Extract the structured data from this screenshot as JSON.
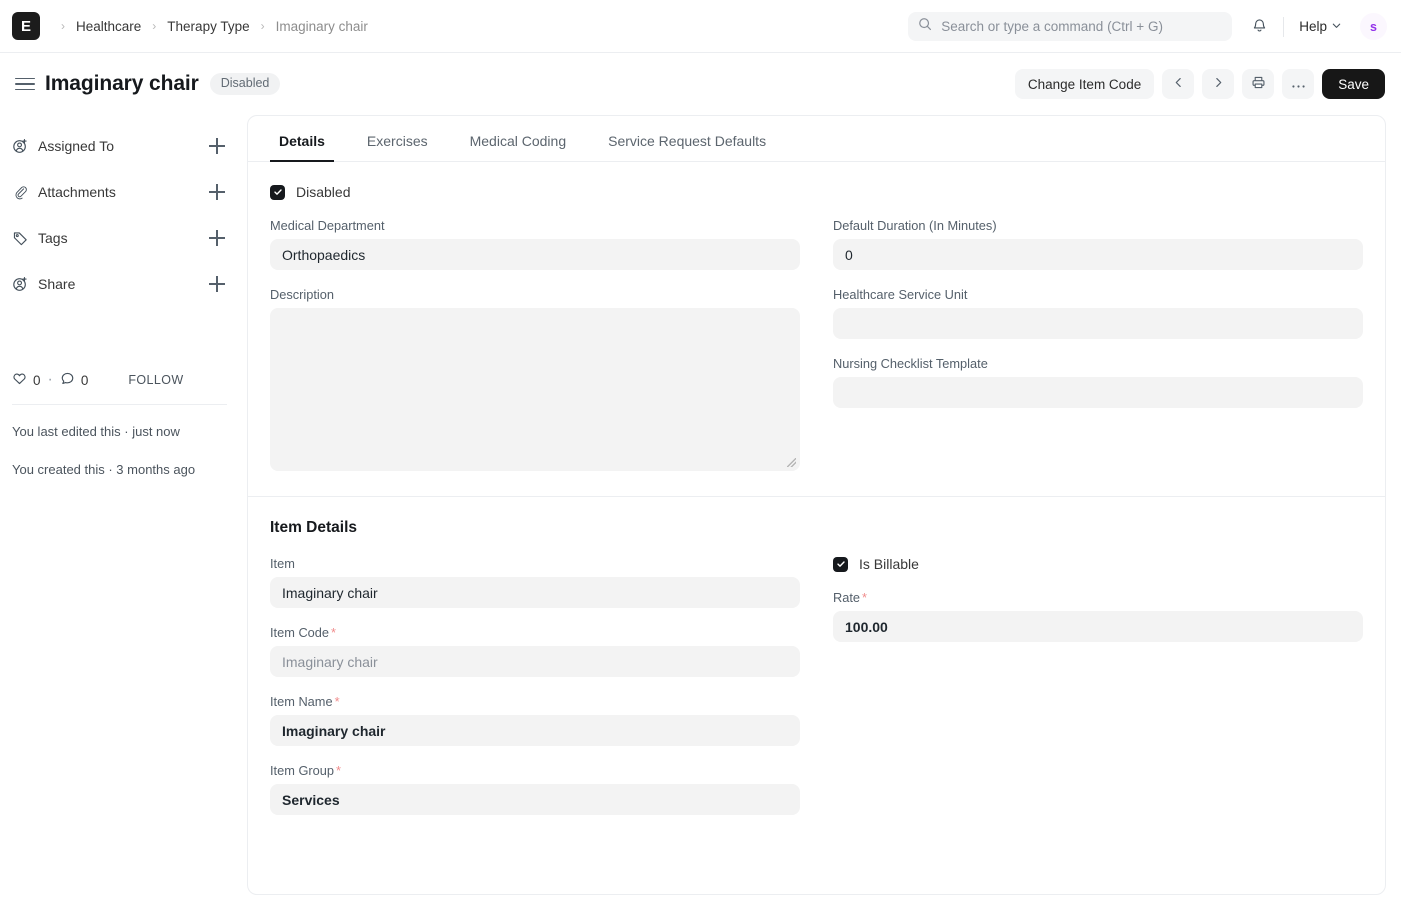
{
  "navbar": {
    "logo_letter": "E",
    "logo_icon": "erpnext-logo-icon",
    "breadcrumbs": [
      {
        "label": "Healthcare",
        "muted": false
      },
      {
        "label": "Therapy Type",
        "muted": false
      },
      {
        "label": "Imaginary chair",
        "muted": true
      }
    ],
    "separator": "›",
    "search": {
      "placeholder": "Search or type a command (Ctrl + G)",
      "value": "",
      "icon": "search-icon"
    },
    "notifications_icon": "bell-icon",
    "help_label": "Help",
    "help_caret_icon": "chevron-down-icon",
    "avatar_letter": "s",
    "avatar_bg": "#fbf7fe",
    "avatar_color": "#9333ea"
  },
  "page_header": {
    "menu_icon": "hamburger-icon",
    "title": "Imaginary chair",
    "status": "Disabled",
    "actions": {
      "change_item_code": "Change Item Code",
      "prev_icon": "chevron-left-icon",
      "next_icon": "chevron-right-icon",
      "print_icon": "printer-icon",
      "more_icon": "ellipsis-icon",
      "save": "Save"
    }
  },
  "sidebar": {
    "items": [
      {
        "label": "Assigned To",
        "icon": "user-plus-icon",
        "add_icon": "plus-icon"
      },
      {
        "label": "Attachments",
        "icon": "paperclip-icon",
        "add_icon": "plus-icon"
      },
      {
        "label": "Tags",
        "icon": "tag-icon",
        "add_icon": "plus-icon"
      },
      {
        "label": "Share",
        "icon": "user-plus-icon",
        "add_icon": "plus-icon"
      }
    ],
    "stats": {
      "like_icon": "heart-icon",
      "like_count": "0",
      "separator": "·",
      "comment_icon": "comment-icon",
      "comment_count": "0",
      "follow_label": "FOLLOW"
    },
    "meta": [
      "You last edited this · just now",
      "You created this · 3 months ago"
    ]
  },
  "main": {
    "tabs": [
      {
        "label": "Details",
        "active": true
      },
      {
        "label": "Exercises",
        "active": false
      },
      {
        "label": "Medical Coding",
        "active": false
      },
      {
        "label": "Service Request Defaults",
        "active": false
      }
    ],
    "disabled_checkbox": {
      "label": "Disabled",
      "checked": true
    },
    "details": {
      "medical_department": {
        "label": "Medical Department",
        "value": "Orthopaedics"
      },
      "description": {
        "label": "Description",
        "value": ""
      },
      "default_duration": {
        "label": "Default Duration (In Minutes)",
        "value": "0"
      },
      "healthcare_service_unit": {
        "label": "Healthcare Service Unit",
        "value": ""
      },
      "nursing_checklist_template": {
        "label": "Nursing Checklist Template",
        "value": ""
      }
    },
    "item_details": {
      "title": "Item Details",
      "item": {
        "label": "Item",
        "value": "Imaginary chair"
      },
      "item_code": {
        "label": "Item Code",
        "required": "*",
        "value": "Imaginary chair"
      },
      "item_name": {
        "label": "Item Name",
        "required": "*",
        "value": "Imaginary chair"
      },
      "item_group": {
        "label": "Item Group",
        "required": "*",
        "value": "Services"
      },
      "is_billable": {
        "label": "Is Billable",
        "checked": true
      },
      "rate": {
        "label": "Rate",
        "required": "*",
        "value": "100.00"
      }
    }
  }
}
